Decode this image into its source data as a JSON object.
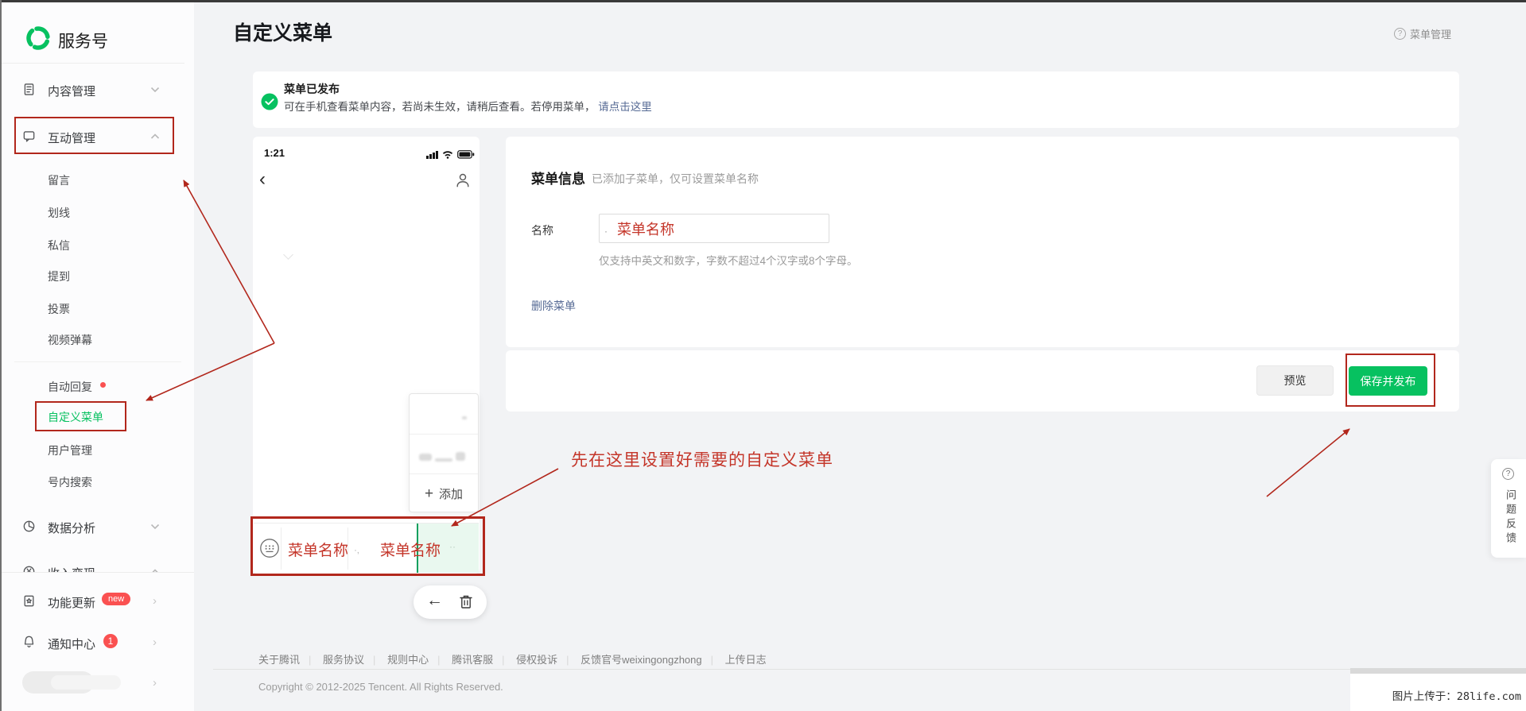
{
  "colors": {
    "brand_green": "#07c160",
    "annotation_red": "#b2271c",
    "link_blue": "#576b95",
    "badge_red": "#fa5151"
  },
  "icons": {
    "back_chevron": "‹",
    "left_arrow": "←",
    "plus": "+",
    "separator": "|",
    "input_mark": "·",
    "censored_dots": "·‚",
    "censored_dots2": "··"
  },
  "sidebar": {
    "logo": "服务号",
    "item_content": "内容管理",
    "item_interact": "互动管理",
    "sub_items": [
      "留言",
      "划线",
      "私信",
      "提到",
      "投票",
      "视频弹幕"
    ],
    "sub_items2": [
      "自动回复",
      "自定义菜单",
      "用户管理",
      "号内搜索"
    ],
    "item_data": "数据分析",
    "item_income": "收入变现",
    "item_feature": "功能更新",
    "feature_badge": "new",
    "item_notify": "通知中心",
    "notify_badge": "1"
  },
  "header": {
    "title": "自定义菜单",
    "help": "菜单管理",
    "help_q": "?"
  },
  "banner": {
    "title": "菜单已发布",
    "body": "可在手机查看菜单内容，若尚未生效，请稍后查看。若停用菜单，",
    "link": "请点击这里"
  },
  "phone": {
    "time": "1:21",
    "popup_add": "添加",
    "menu_left": "菜单名称",
    "menu_right": "菜单名称"
  },
  "form": {
    "section_title": "菜单信息",
    "section_subtitle": "已添加子菜单，仅可设置菜单名称",
    "name_label": "名称",
    "name_value": "菜单名称",
    "hint": "仅支持中英文和数字，字数不超过4个汉字或8个字母。",
    "delete_link": "删除菜单"
  },
  "actions": {
    "preview": "预览",
    "save": "保存并发布"
  },
  "annotation": {
    "tip": "先在这里设置好需要的自定义菜单"
  },
  "feedback": {
    "q": "?",
    "label": "问题反馈"
  },
  "footer": {
    "links": [
      "关于腾讯",
      "服务协议",
      "规则中心",
      "腾讯客服",
      "侵权投诉",
      "反馈官号weixingongzhong",
      "上传日志"
    ],
    "copyright": "Copyright © 2012-2025 Tencent. All Rights Reserved."
  },
  "watermark": {
    "text": "图片上传于：28life.com"
  }
}
